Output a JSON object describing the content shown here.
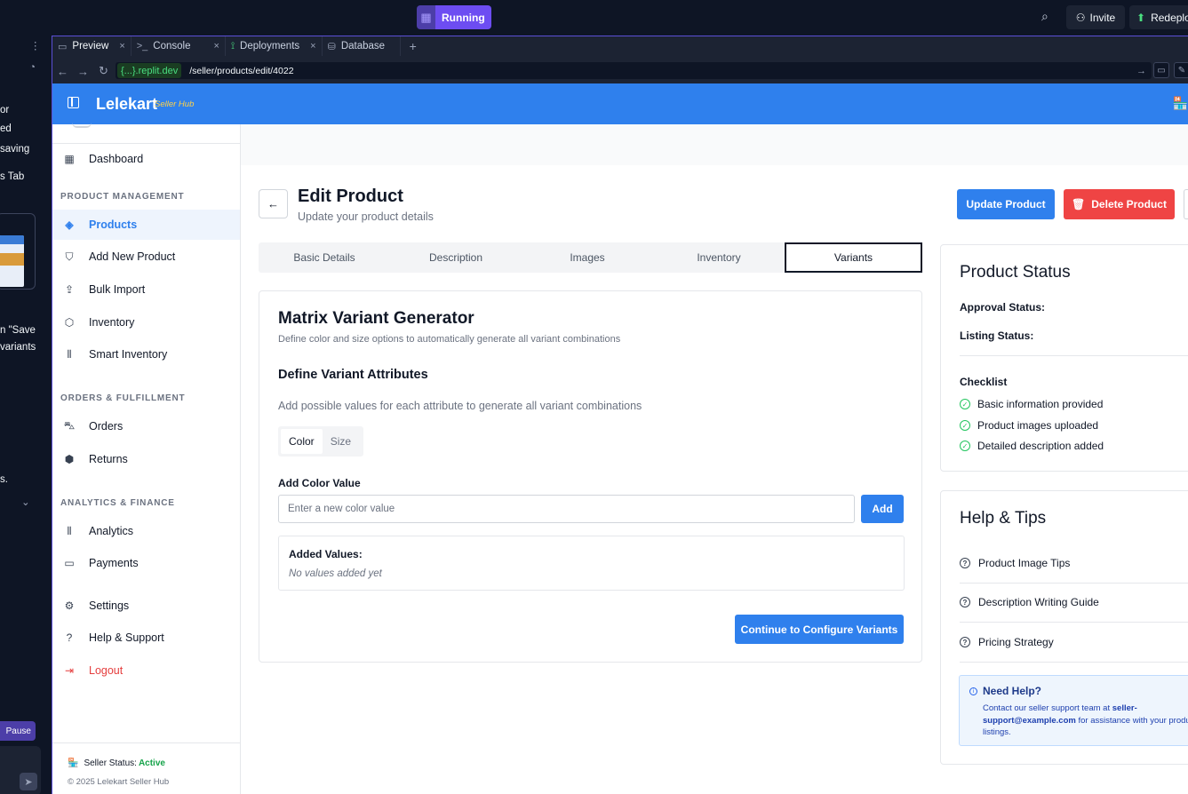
{
  "replit": {
    "run_label": "Running",
    "invite_label": "Invite",
    "redeploy_label": "Redeploy",
    "pause_label": "Pause",
    "left_fragments": [
      "or",
      "ed",
      "saving",
      "s Tab",
      "n \"Save",
      "variants",
      "s."
    ]
  },
  "browser": {
    "tabs": [
      {
        "label": "Preview"
      },
      {
        "label": "Console"
      },
      {
        "label": "Deployments"
      },
      {
        "label": "Database"
      }
    ],
    "url_host": "{...}.replit.dev",
    "url_path": "/seller/products/edit/4022"
  },
  "app": {
    "brand": "Lelekart",
    "brand_sub": "Seller Hub"
  },
  "sidebar": {
    "dashboard": "Dashboard",
    "section_product": "PRODUCT MANAGEMENT",
    "products": "Products",
    "add_new_product": "Add New Product",
    "bulk_import": "Bulk Import",
    "inventory": "Inventory",
    "smart_inventory": "Smart Inventory",
    "section_orders": "ORDERS & FULFILLMENT",
    "orders": "Orders",
    "returns": "Returns",
    "section_analytics": "ANALYTICS & FINANCE",
    "analytics": "Analytics",
    "payments": "Payments",
    "settings": "Settings",
    "help_support": "Help & Support",
    "logout": "Logout",
    "seller_status_label": "Seller Status:",
    "seller_status_value": "Active",
    "copyright": "© 2025 Lelekart Seller Hub"
  },
  "page": {
    "title": "Edit Product",
    "subtitle": "Update your product details",
    "update_button": "Update Product",
    "delete_button": "Delete Product"
  },
  "tabs": [
    "Basic Details",
    "Description",
    "Images",
    "Inventory",
    "Variants"
  ],
  "variants": {
    "title": "Matrix Variant Generator",
    "subtitle": "Define color and size options to automatically generate all variant combinations",
    "section_title": "Define Variant Attributes",
    "section_subtitle": "Add possible values for each attribute to generate all variant combinations",
    "attr_tabs": [
      "Color",
      "Size"
    ],
    "field_label": "Add Color Value",
    "input_placeholder": "Enter a new color value",
    "input_value": "",
    "add_button": "Add",
    "added_title": "Added Values:",
    "added_empty": "No values added yet",
    "continue_button": "Continue to Configure Variants"
  },
  "status_card": {
    "title": "Product Status",
    "approval_label": "Approval Status:",
    "listing_label": "Listing Status:",
    "checklist_title": "Checklist",
    "checklist": [
      "Basic information provided",
      "Product images uploaded",
      "Detailed description added"
    ]
  },
  "help_card": {
    "title": "Help & Tips",
    "items": [
      "Product Image Tips",
      "Description Writing Guide",
      "Pricing Strategy"
    ],
    "need_help_title": "Need Help?",
    "need_help_pre": "Contact our seller support team at ",
    "need_help_email": "seller-support@example.com",
    "need_help_post": " for assistance with your product listings."
  }
}
